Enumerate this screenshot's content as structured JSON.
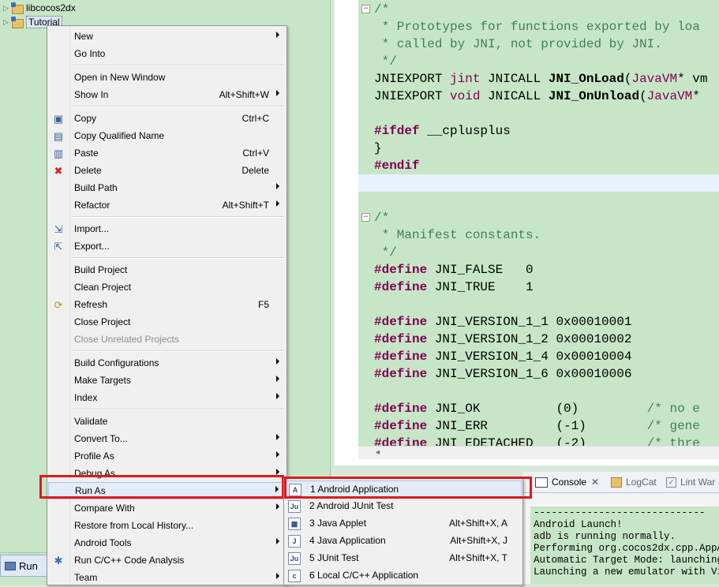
{
  "explorer": {
    "items": [
      {
        "label": "libcocos2dx"
      },
      {
        "label": "Tutorial"
      }
    ]
  },
  "run_tab": {
    "label": "Run"
  },
  "editor": {
    "lines": [
      "/*",
      " * Prototypes for functions exported by loa",
      " * called by JNI, not provided by JNI.",
      " */",
      "JNIEXPORT jint JNICALL JNI_OnLoad(JavaVM* vm",
      "JNIEXPORT void JNICALL JNI_OnUnload(JavaVM*",
      "",
      "#ifdef __cplusplus",
      "}",
      "#endif",
      "",
      "",
      "/*",
      " * Manifest constants.",
      " */",
      "#define JNI_FALSE   0",
      "#define JNI_TRUE    1",
      "",
      "#define JNI_VERSION_1_1 0x00010001",
      "#define JNI_VERSION_1_2 0x00010002",
      "#define JNI_VERSION_1_4 0x00010004",
      "#define JNI_VERSION_1_6 0x00010006",
      "",
      "#define JNI_OK          (0)         /* no e",
      "#define JNI_ERR         (-1)        /* gene",
      "#define JNI_EDETACHED   (-2)        /* thre"
    ]
  },
  "console": {
    "tabs": [
      {
        "label": "Console",
        "icon": "console-icon"
      },
      {
        "label": "LogCat",
        "icon": "logcat-icon"
      },
      {
        "label": "Lint War",
        "icon": "lint-icon"
      }
    ],
    "lines": [
      "-----------------------------",
      "Android Launch!",
      "adb is running normally.",
      "Performing org.cocos2dx.cpp.AppAc",
      "Automatic Target Mode: launching",
      "Launching a new emulator with Vir"
    ]
  },
  "context_menu": {
    "items": [
      {
        "label": "New",
        "submenu": true
      },
      {
        "label": "Go Into"
      },
      {
        "label": "Open in New Window"
      },
      {
        "label": "Show In",
        "shortcut": "Alt+Shift+W",
        "submenu": true
      },
      {
        "label": "Copy",
        "shortcut": "Ctrl+C",
        "icon": "copy-icon"
      },
      {
        "label": "Copy Qualified Name",
        "icon": "copy-qualified-icon"
      },
      {
        "label": "Paste",
        "shortcut": "Ctrl+V",
        "icon": "paste-icon"
      },
      {
        "label": "Delete",
        "shortcut": "Delete",
        "icon": "delete-icon"
      },
      {
        "label": "Build Path",
        "submenu": true
      },
      {
        "label": "Refactor",
        "shortcut": "Alt+Shift+T",
        "submenu": true
      },
      {
        "label": "Import...",
        "icon": "import-icon"
      },
      {
        "label": "Export...",
        "icon": "export-icon"
      },
      {
        "label": "Build Project"
      },
      {
        "label": "Clean Project"
      },
      {
        "label": "Refresh",
        "shortcut": "F5",
        "icon": "refresh-icon"
      },
      {
        "label": "Close Project"
      },
      {
        "label": "Close Unrelated Projects",
        "disabled": true
      },
      {
        "label": "Build Configurations",
        "submenu": true
      },
      {
        "label": "Make Targets",
        "submenu": true
      },
      {
        "label": "Index",
        "submenu": true
      },
      {
        "label": "Validate"
      },
      {
        "label": "Convert To...",
        "submenu": true
      },
      {
        "label": "Profile As",
        "submenu": true
      },
      {
        "label": "Debug As",
        "submenu": true
      },
      {
        "label": "Run As",
        "submenu": true
      },
      {
        "label": "Compare With",
        "submenu": true
      },
      {
        "label": "Restore from Local History..."
      },
      {
        "label": "Android Tools",
        "submenu": true
      },
      {
        "label": "Run C/C++ Code Analysis",
        "icon": "code-analysis-icon"
      },
      {
        "label": "Team",
        "submenu": true
      }
    ]
  },
  "run_as_menu": {
    "items": [
      {
        "label": "1 Android Application",
        "icon": "android-app-icon"
      },
      {
        "label": "2 Android JUnit Test",
        "icon": "junit-icon"
      },
      {
        "label": "3 Java Applet",
        "shortcut": "Alt+Shift+X, A",
        "icon": "applet-icon"
      },
      {
        "label": "4 Java Application",
        "shortcut": "Alt+Shift+X, J",
        "icon": "java-app-icon"
      },
      {
        "label": "5 JUnit Test",
        "shortcut": "Alt+Shift+X, T",
        "icon": "junit-icon"
      },
      {
        "label": "6 Local C/C++ Application",
        "icon": "cpp-app-icon"
      }
    ]
  },
  "colors": {
    "highlight_box": "#e0181e",
    "editor_background": "#c7e6c7",
    "keyword": "#7f0055",
    "comment": "#3f7f5f"
  }
}
